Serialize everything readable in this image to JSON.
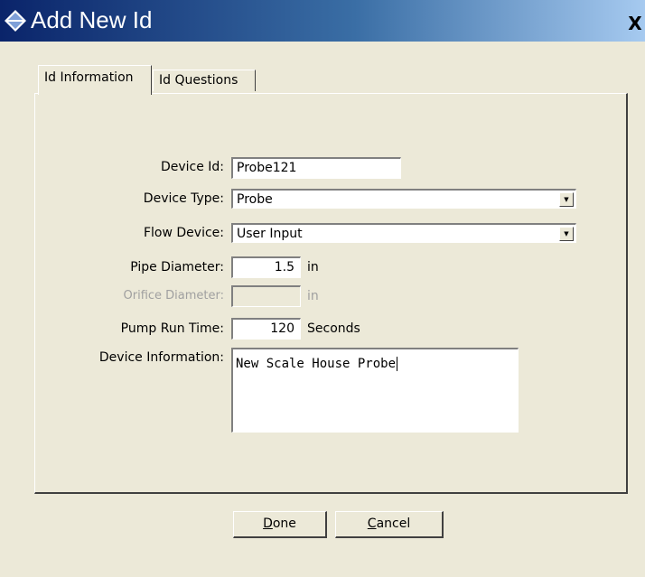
{
  "window": {
    "title": "Add New Id",
    "close_symbol": "X"
  },
  "tabs": [
    {
      "label": "Id Information",
      "active": true
    },
    {
      "label": "Id Questions",
      "active": false
    }
  ],
  "form": {
    "device_id": {
      "label": "Device Id:",
      "value": "Probe121"
    },
    "device_type": {
      "label": "Device Type:",
      "value": "Probe"
    },
    "flow_device": {
      "label": "Flow Device:",
      "value": "User Input"
    },
    "pipe_diameter": {
      "label": "Pipe Diameter:",
      "value": "1.5",
      "unit": "in"
    },
    "orifice_diameter": {
      "label": "Orifice Diameter:",
      "value": "",
      "unit": "in",
      "disabled": true
    },
    "pump_run_time": {
      "label": "Pump Run Time:",
      "value": "120",
      "unit": "Seconds"
    },
    "device_information": {
      "label": "Device Information:",
      "value": "New Scale House Probe"
    }
  },
  "buttons": {
    "done_mnemonic": "D",
    "done_rest": "one",
    "cancel_mnemonic": "C",
    "cancel_rest": "ancel"
  },
  "colors": {
    "titlebar_start": "#0a246a",
    "titlebar_end": "#a6caf0",
    "dialog_bg": "#ece9d8"
  },
  "icons": {
    "title": "diamond-app-icon",
    "dropdown": "triangle-down-icon"
  }
}
